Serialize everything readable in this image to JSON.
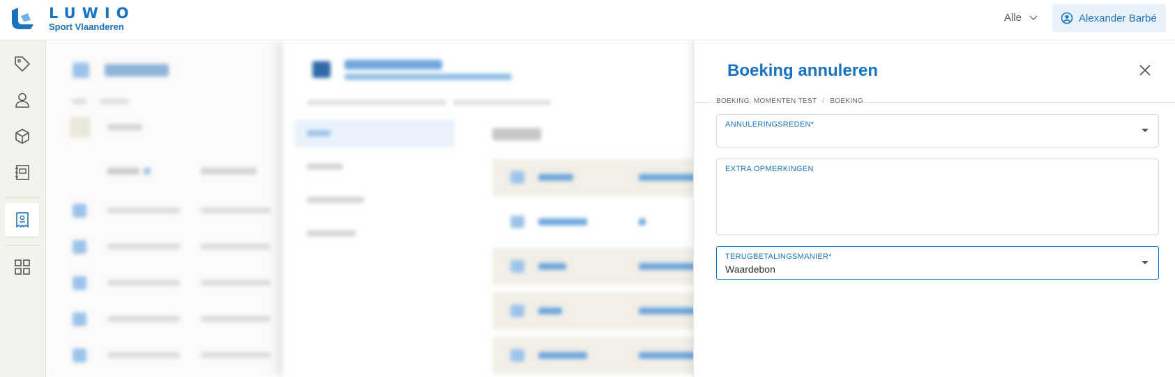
{
  "brand": {
    "name": "LUWIO",
    "subtitle": "Sport Vlaanderen"
  },
  "header": {
    "scope_label": "Alle",
    "user_name": "Alexander Barbé"
  },
  "sidebar": {
    "items": [
      {
        "icon": "tag-icon",
        "active": false
      },
      {
        "icon": "user-icon",
        "active": false
      },
      {
        "icon": "box-icon",
        "active": false
      },
      {
        "icon": "contacts-book-icon",
        "active": false
      },
      {
        "icon": "receipt-icon",
        "active": true
      },
      {
        "icon": "apps-grid-icon",
        "active": false
      }
    ]
  },
  "panel": {
    "title": "Boeking annuleren",
    "breadcrumb": [
      "BOEKING: MOMENTEN TEST",
      "BOEKING"
    ],
    "fields": {
      "reason": {
        "label": "ANNULERINGSREDEN*",
        "value": ""
      },
      "remarks": {
        "label": "EXTRA OPMERKINGEN",
        "value": ""
      },
      "refund": {
        "label": "TERUGBETALINGSMANIER*",
        "value": "Waardebon"
      }
    }
  },
  "colors": {
    "accent": "#1a73c0",
    "sidebar_bg": "#f3f2ec",
    "accent_light": "#e9f2fb"
  }
}
